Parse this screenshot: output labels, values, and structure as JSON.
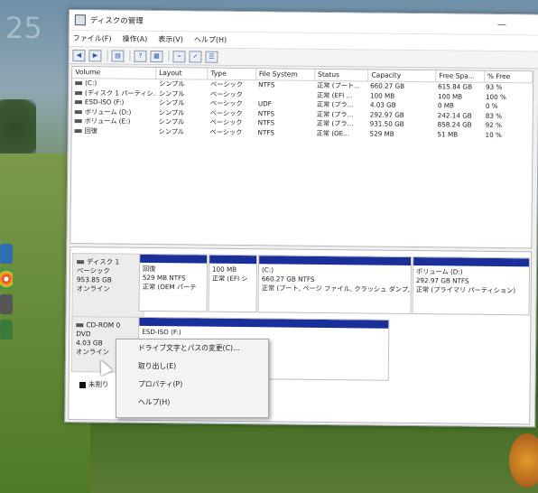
{
  "desktop": {
    "clock": "25"
  },
  "window": {
    "title": "ディスクの管理",
    "menu": [
      "ファイル(F)",
      "操作(A)",
      "表示(V)",
      "ヘルプ(H)"
    ]
  },
  "volume_table": {
    "headers": [
      "Volume",
      "Layout",
      "Type",
      "File System",
      "Status",
      "Capacity",
      "Free Spa...",
      "% Free"
    ],
    "rows": [
      [
        "(C:)",
        "シンプル",
        "ベーシック",
        "NTFS",
        "正常 (ブート...",
        "660.27 GB",
        "615.84 GB",
        "93 %"
      ],
      [
        "(ディスク 1 パーティシ...",
        "シンプル",
        "ベーシック",
        "",
        "正常 (EFI ...",
        "100 MB",
        "100 MB",
        "100 %"
      ],
      [
        "ESD-ISO (F:)",
        "シンプル",
        "ベーシック",
        "UDF",
        "正常 (プラ...",
        "4.03 GB",
        "0 MB",
        "0 %"
      ],
      [
        "ボリューム (D:)",
        "シンプル",
        "ベーシック",
        "NTFS",
        "正常 (プラ...",
        "292.97 GB",
        "242.14 GB",
        "83 %"
      ],
      [
        "ボリューム (E:)",
        "シンプル",
        "ベーシック",
        "NTFS",
        "正常 (プラ...",
        "931.50 GB",
        "858.24 GB",
        "92 %"
      ],
      [
        "回復",
        "シンプル",
        "ベーシック",
        "NTFS",
        "正常 (OE...",
        "529 MB",
        "51 MB",
        "10 %"
      ]
    ]
  },
  "disk1": {
    "name": "ディスク 1",
    "type": "ベーシック",
    "size": "953.85 GB",
    "status": "オンライン",
    "partitions": [
      {
        "name": "回復",
        "size": "529 MB NTFS",
        "status": "正常 (OEM パーテ"
      },
      {
        "name": "",
        "size": "100 MB",
        "status": "正常 (EFI シ"
      },
      {
        "name": "(C:)",
        "size": "660.27 GB NTFS",
        "status": "正常 (ブート, ページ ファイル, クラッシュ ダンプ,"
      },
      {
        "name": "ボリューム (D:)",
        "size": "292.97 GB NTFS",
        "status": "正常 (プライマリ パーティション)"
      }
    ]
  },
  "cdrom": {
    "name": "CD-ROM 0",
    "type": "DVD",
    "size": "4.03 GB",
    "status": "オンライン",
    "partition": "ESD-ISO (F:)"
  },
  "legend": {
    "unallocated": "未割り"
  },
  "context_menu": {
    "items": [
      "ドライブ文字とパスの変更(C)...",
      "取り出し(E)",
      "プロパティ(P)",
      "ヘルプ(H)"
    ]
  }
}
